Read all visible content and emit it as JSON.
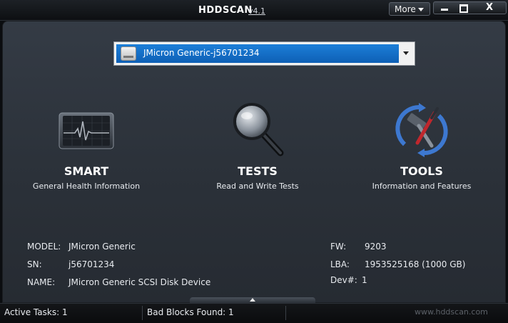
{
  "window": {
    "title": "HDDSCAN",
    "version": "v4.1",
    "more_label": "More",
    "controls": [
      "minimize-icon",
      "maximize-icon",
      "close-icon"
    ],
    "close_glyph": "X"
  },
  "drive_selector": {
    "selected": "JMicron Generic-j56701234",
    "icon": "hard-drive-icon"
  },
  "features": [
    {
      "title": "SMART",
      "description": "General Health Information",
      "icon": "heart-monitor-icon"
    },
    {
      "title": "TESTS",
      "description": "Read and Write Tests",
      "icon": "magnifier-icon"
    },
    {
      "title": "TOOLS",
      "description": "Information and Features",
      "icon": "tools-icon"
    }
  ],
  "drive_info": {
    "model_label": "MODEL:",
    "model": "JMicron Generic",
    "sn_label": "SN:",
    "sn": "j56701234",
    "name_label": "NAME:",
    "name": "JMicron Generic SCSI Disk Device",
    "fw_label": "FW:",
    "fw": "9203",
    "lba_label": "LBA:",
    "lba": "1953525168 (1000 GB)",
    "dev_label": "Dev#:",
    "dev": "1"
  },
  "status_bar": {
    "active_tasks": "Active Tasks: 1",
    "bad_blocks": "Bad Blocks Found: 1",
    "website": "www.hddscan.com"
  },
  "colors": {
    "selection_blue": "#1c7fd8",
    "background": "#2b3139"
  }
}
